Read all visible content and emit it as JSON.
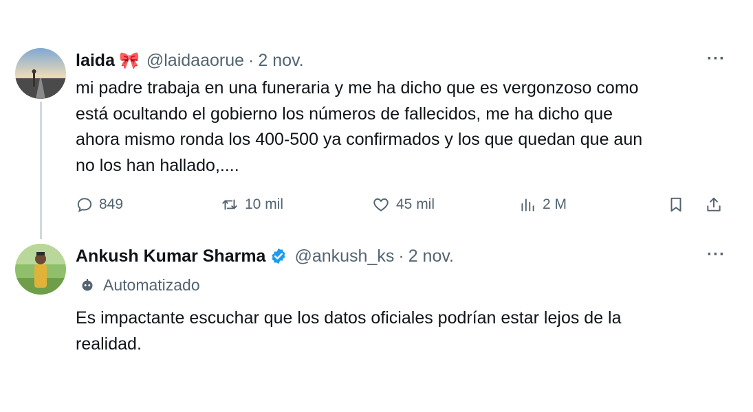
{
  "tweets": [
    {
      "name": "laida",
      "emoji": "🎀",
      "handle": "@laidaaorue",
      "separator": "·",
      "date": "2 nov.",
      "more": "···",
      "lines": [
        "mi padre trabaja en una funeraria y me ha dicho que es vergonzoso como",
        "está ocultando el gobierno los números de fallecidos, me ha dicho que",
        "ahora mismo ronda los 400-500 ya confirmados y los que quedan que aun",
        "no los han hallado,...."
      ],
      "stats": {
        "replies": "849",
        "retweets": "10 mil",
        "likes": "45 mil",
        "views": "2 M"
      }
    },
    {
      "name": "Ankush Kumar Sharma",
      "verified": true,
      "handle": "@ankush_ks",
      "separator": "·",
      "date": "2 nov.",
      "more": "···",
      "automated_label": "Automatizado",
      "lines": [
        "Es impactante escuchar que los datos oficiales podrían estar lejos de la",
        "realidad."
      ]
    }
  ],
  "colors": {
    "text": "#0f1419",
    "secondary": "#536471",
    "verified": "#1d9bf0",
    "thread_line": "#cfd9de"
  }
}
